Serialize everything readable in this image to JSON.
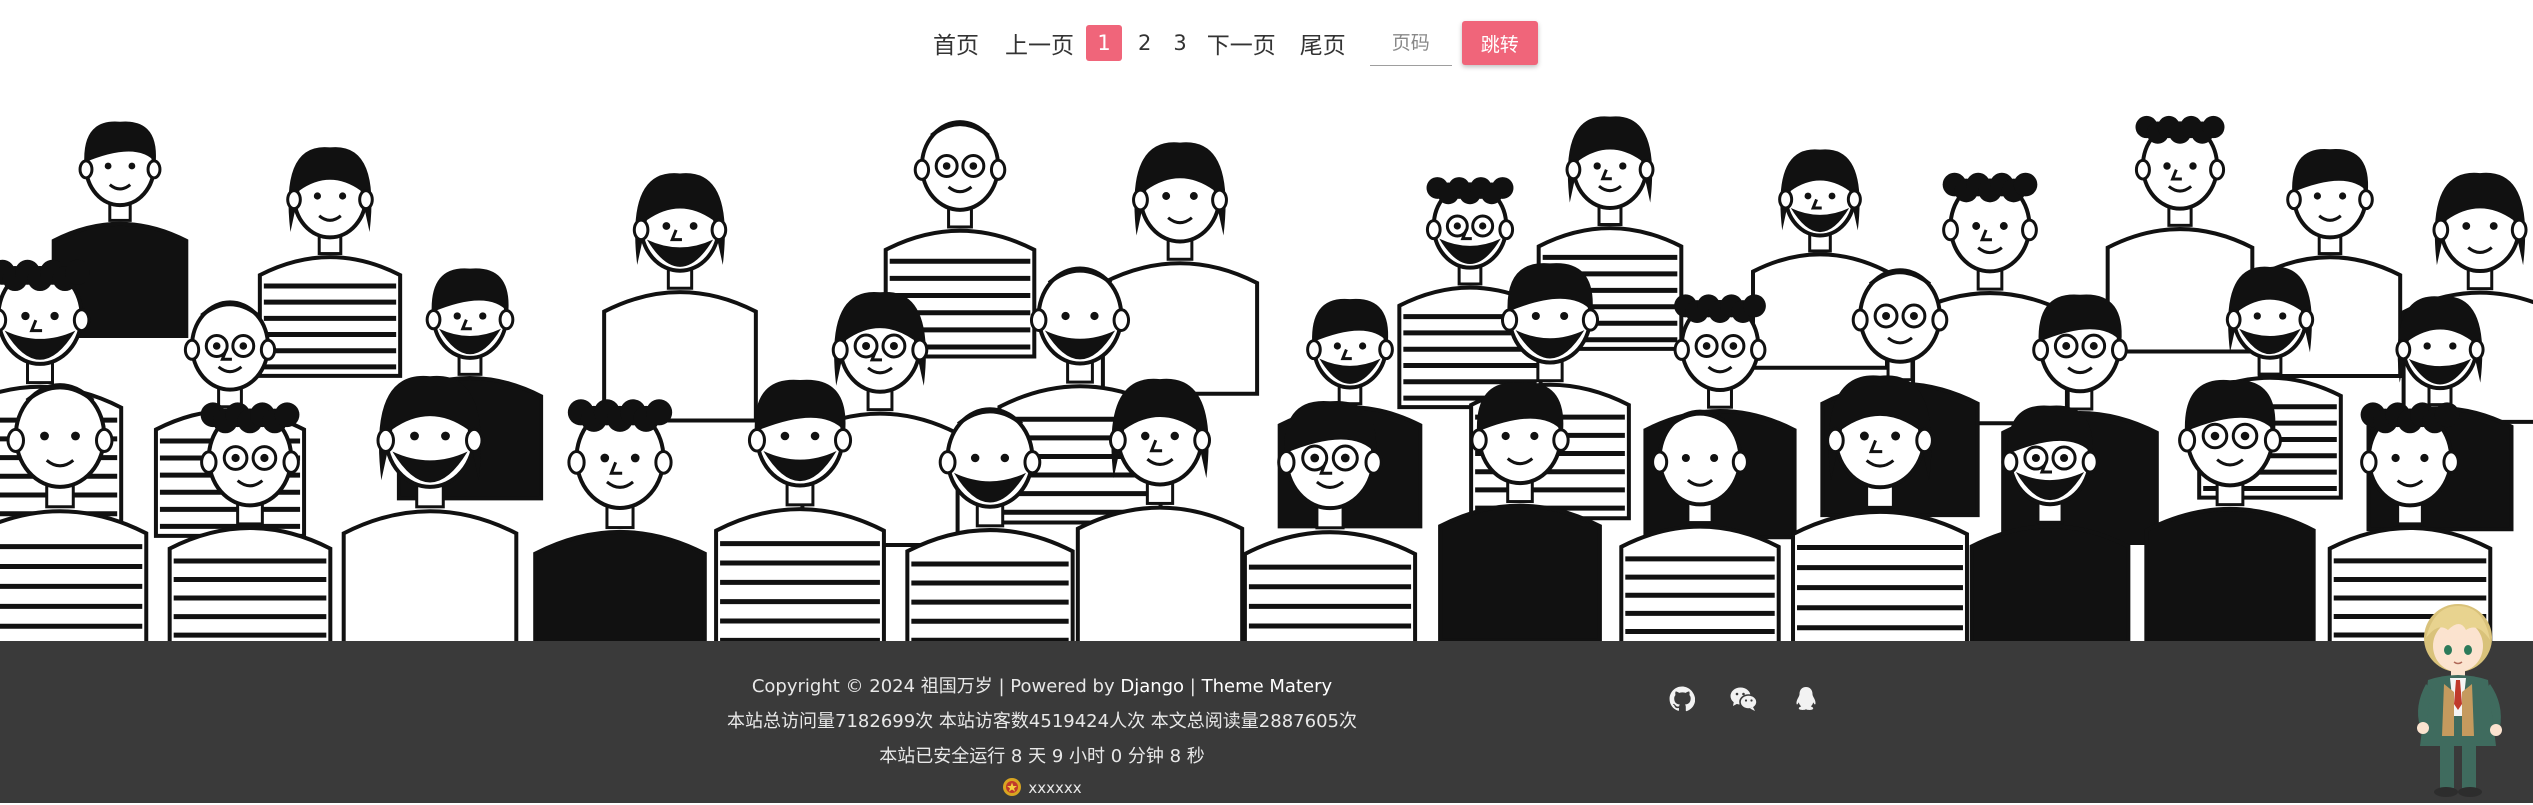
{
  "pagination": {
    "first": "首页",
    "prev": "上一页",
    "pages": [
      "1",
      "2",
      "3"
    ],
    "current": "1",
    "next": "下一页",
    "last": "尾页",
    "input_placeholder": "页码",
    "go": "跳转"
  },
  "footer": {
    "copyright_prefix": "Copyright © 2024 祖国万岁 | Powered by ",
    "django_link": "Django",
    "separator": " | ",
    "theme_link": "Theme Matery",
    "stats": "本站总访问量7182699次 本站访客数4519424人次 本文总阅读量2887605次",
    "uptime": "本站已安全运行 8 天 9 小时 0 分钟 8 秒",
    "beian": "xxxxxx"
  },
  "social_icons": [
    "github-icon",
    "wechat-icon",
    "qq-icon"
  ],
  "colors": {
    "accent": "#f0657a",
    "footer_bg": "#3a3a3a",
    "footer_text": "#e8e8e8"
  }
}
